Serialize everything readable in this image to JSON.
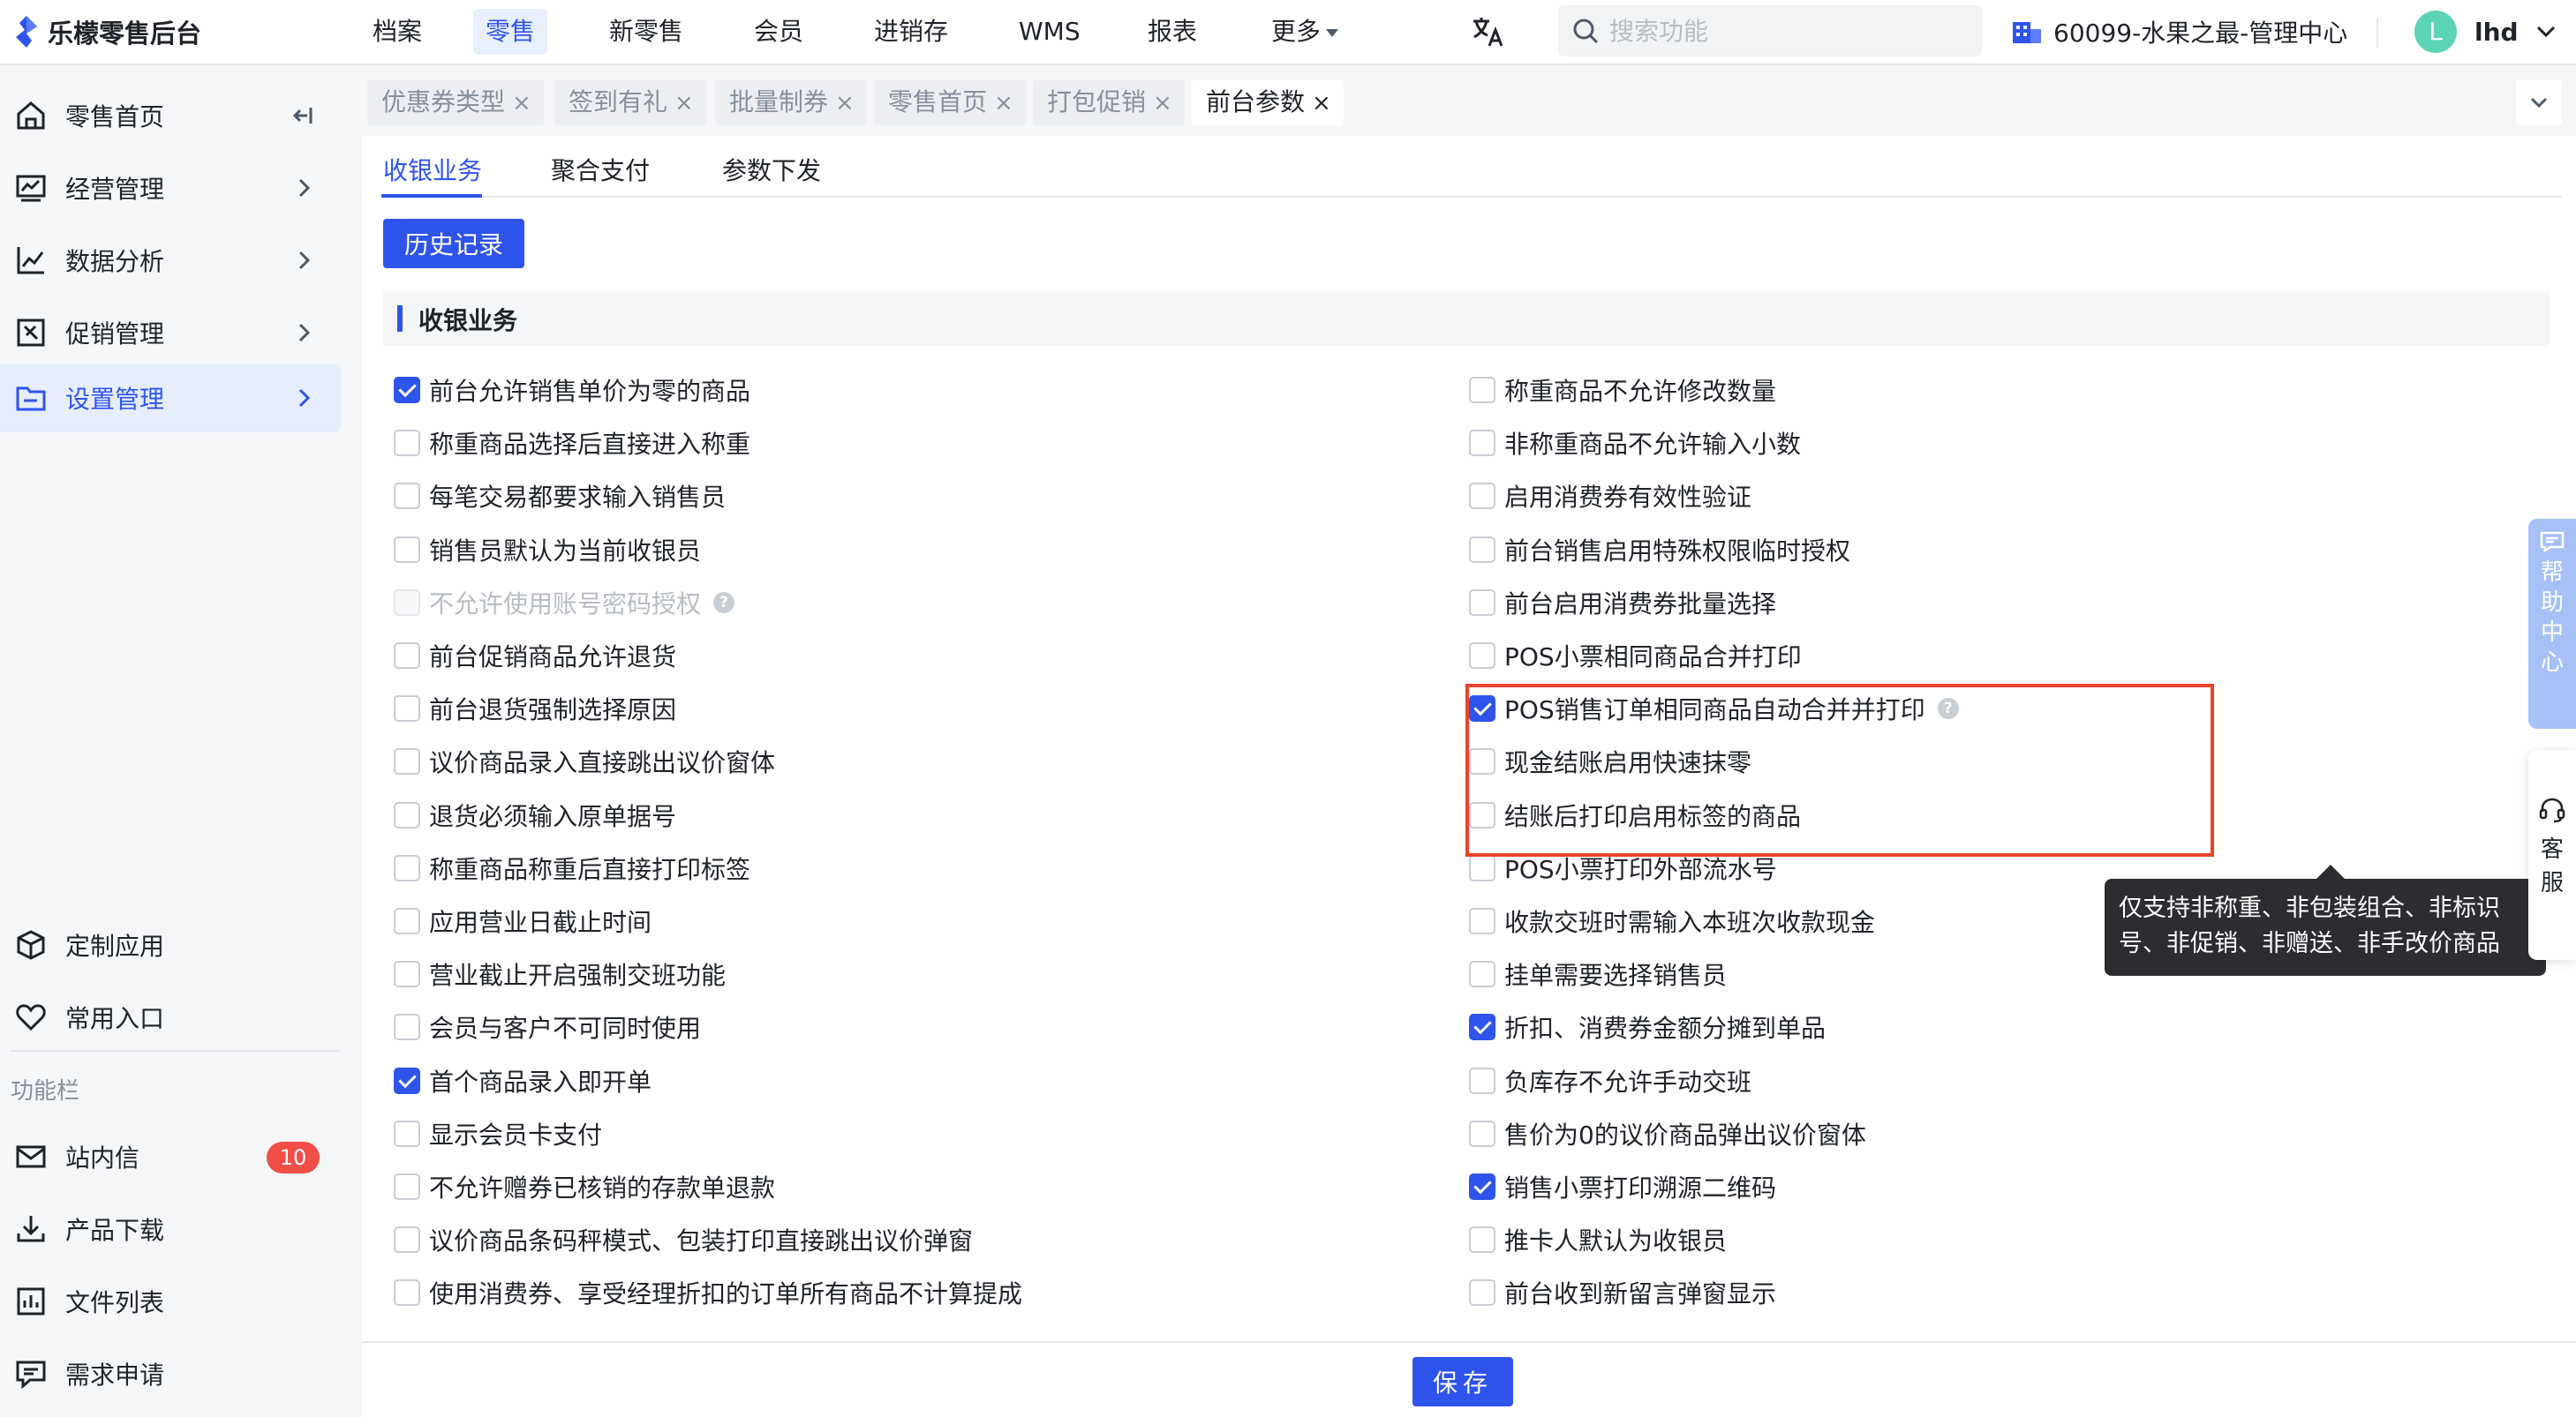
{
  "brand": {
    "name": "乐檬零售后台"
  },
  "topnav": {
    "items": [
      "档案",
      "零售",
      "新零售",
      "会员",
      "进销存",
      "WMS",
      "报表",
      "更多"
    ],
    "active_index": 1
  },
  "search": {
    "placeholder": "搜索功能"
  },
  "store": {
    "label": "60099-水果之最-管理中心"
  },
  "user": {
    "avatar_letter": "L",
    "name": "lhd"
  },
  "sidebar": {
    "main_items": [
      {
        "label": "零售首页",
        "icon": "home-icon"
      },
      {
        "label": "经营管理",
        "icon": "chart-board-icon"
      },
      {
        "label": "数据分析",
        "icon": "line-chart-icon"
      },
      {
        "label": "促销管理",
        "icon": "promotion-icon"
      },
      {
        "label": "设置管理",
        "icon": "folder-icon"
      }
    ],
    "active_index": 4,
    "bottom_items": [
      {
        "label": "定制应用",
        "icon": "cube-icon"
      },
      {
        "label": "常用入口",
        "icon": "heart-icon"
      }
    ],
    "section_label": "功能栏",
    "function_items": [
      {
        "label": "站内信",
        "icon": "mail-icon",
        "badge": "10"
      },
      {
        "label": "产品下载",
        "icon": "download-icon"
      },
      {
        "label": "文件列表",
        "icon": "file-list-icon"
      },
      {
        "label": "需求申请",
        "icon": "request-icon"
      }
    ]
  },
  "page_tabs": {
    "items": [
      "优惠券类型",
      "签到有礼",
      "批量制券",
      "零售首页",
      "打包促销",
      "前台参数"
    ],
    "active_index": 5,
    "close_glyph": "×"
  },
  "sub_tabs": {
    "items": [
      "收银业务",
      "聚合支付",
      "参数下发"
    ],
    "active_index": 0
  },
  "history_button": "历史记录",
  "section_title": "收银业务",
  "options_left": [
    {
      "label": "前台允许销售单价为零的商品",
      "checked": true
    },
    {
      "label": "称重商品选择后直接进入称重",
      "checked": false
    },
    {
      "label": "每笔交易都要求输入销售员",
      "checked": false
    },
    {
      "label": "销售员默认为当前收银员",
      "checked": false
    },
    {
      "label": "不允许使用账号密码授权",
      "checked": false,
      "disabled": true,
      "help": true
    },
    {
      "label": "前台促销商品允许退货",
      "checked": false
    },
    {
      "label": "前台退货强制选择原因",
      "checked": false
    },
    {
      "label": "议价商品录入直接跳出议价窗体",
      "checked": false
    },
    {
      "label": "退货必须输入原单据号",
      "checked": false
    },
    {
      "label": "称重商品称重后直接打印标签",
      "checked": false
    },
    {
      "label": "应用营业日截止时间",
      "checked": false
    },
    {
      "label": "营业截止开启强制交班功能",
      "checked": false
    },
    {
      "label": "会员与客户不可同时使用",
      "checked": false
    },
    {
      "label": "首个商品录入即开单",
      "checked": true
    },
    {
      "label": "显示会员卡支付",
      "checked": false
    },
    {
      "label": "不允许赠券已核销的存款单退款",
      "checked": false
    },
    {
      "label": "议价商品条码秤模式、包装打印直接跳出议价弹窗",
      "checked": false
    },
    {
      "label": "使用消费券、享受经理折扣的订单所有商品不计算提成",
      "checked": false
    }
  ],
  "options_right": [
    {
      "label": "称重商品不允许修改数量",
      "checked": false
    },
    {
      "label": "非称重商品不允许输入小数",
      "checked": false
    },
    {
      "label": "启用消费券有效性验证",
      "checked": false
    },
    {
      "label": "前台销售启用特殊权限临时授权",
      "checked": false
    },
    {
      "label": "前台启用消费券批量选择",
      "checked": false
    },
    {
      "label": "POS小票相同商品合并打印",
      "checked": false
    },
    {
      "label": "POS销售订单相同商品自动合并并打印",
      "checked": true,
      "help": true
    },
    {
      "label": "现金结账启用快速抹零",
      "checked": false
    },
    {
      "label": "结账后打印启用标签的商品",
      "checked": false
    },
    {
      "label": "POS小票打印外部流水号",
      "checked": false
    },
    {
      "label": "收款交班时需输入本班次收款现金",
      "checked": false
    },
    {
      "label": "挂单需要选择销售员",
      "checked": false
    },
    {
      "label": "折扣、消费券金额分摊到单品",
      "checked": true
    },
    {
      "label": "负库存不允许手动交班",
      "checked": false
    },
    {
      "label": "售价为0的议价商品弹出议价窗体",
      "checked": false
    },
    {
      "label": "销售小票打印溯源二维码",
      "checked": true
    },
    {
      "label": "推卡人默认为收银员",
      "checked": false
    },
    {
      "label": "前台收到新留言弹窗显示",
      "checked": false
    }
  ],
  "tooltip": {
    "line1": "仅支持非称重、非包装组合、非标识",
    "line2": "号、非促销、非赠送、非手改价商品"
  },
  "help_glyph": "?",
  "save_button": "保存",
  "help_center": "帮助中心",
  "kefu": "客服",
  "colors": {
    "primary": "#2f54eb",
    "highlight": "#e8452c",
    "badge": "#f04e47"
  }
}
